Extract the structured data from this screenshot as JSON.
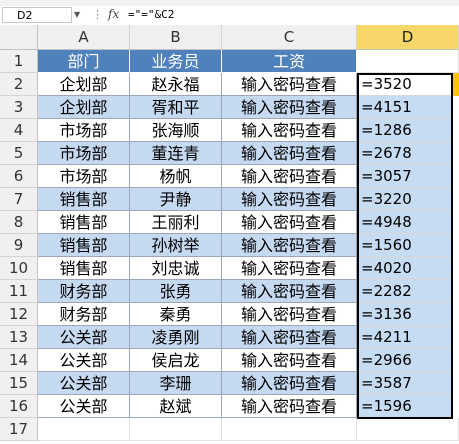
{
  "formula_bar": {
    "name_box": "D2",
    "fx_symbol": "fx",
    "formula": "=\"=\"&C2"
  },
  "columns": [
    "A",
    "B",
    "C",
    "D"
  ],
  "row_numbers": [
    "1",
    "2",
    "3",
    "4",
    "5",
    "6",
    "7",
    "8",
    "9",
    "10",
    "11",
    "12",
    "13",
    "14",
    "15",
    "16",
    "17"
  ],
  "table": {
    "headers": [
      "部门",
      "业务员",
      "工资"
    ],
    "rows": [
      {
        "dept": "企划部",
        "name": "赵永福",
        "salary": "输入密码查看",
        "d": "=3520"
      },
      {
        "dept": "企划部",
        "name": "胥和平",
        "salary": "输入密码查看",
        "d": "=4151"
      },
      {
        "dept": "市场部",
        "name": "张海顺",
        "salary": "输入密码查看",
        "d": "=1286"
      },
      {
        "dept": "市场部",
        "name": "董连青",
        "salary": "输入密码查看",
        "d": "=2678"
      },
      {
        "dept": "市场部",
        "name": "杨帆",
        "salary": "输入密码查看",
        "d": "=3057"
      },
      {
        "dept": "销售部",
        "name": "尹静",
        "salary": "输入密码查看",
        "d": "=3220"
      },
      {
        "dept": "销售部",
        "name": "王丽利",
        "salary": "输入密码查看",
        "d": "=4948"
      },
      {
        "dept": "销售部",
        "name": "孙树举",
        "salary": "输入密码查看",
        "d": "=1560"
      },
      {
        "dept": "销售部",
        "name": "刘忠诚",
        "salary": "输入密码查看",
        "d": "=4020"
      },
      {
        "dept": "财务部",
        "name": "张勇",
        "salary": "输入密码查看",
        "d": "=2282"
      },
      {
        "dept": "财务部",
        "name": "秦勇",
        "salary": "输入密码查看",
        "d": "=3136"
      },
      {
        "dept": "公关部",
        "name": "凌勇刚",
        "salary": "输入密码查看",
        "d": "=4211"
      },
      {
        "dept": "公关部",
        "name": "侯启龙",
        "salary": "输入密码查看",
        "d": "=2966"
      },
      {
        "dept": "公关部",
        "name": "李珊",
        "salary": "输入密码查看",
        "d": "=3587"
      },
      {
        "dept": "公关部",
        "name": "赵斌",
        "salary": "输入密码查看",
        "d": "=1596"
      }
    ]
  },
  "colors": {
    "header_fill": "#4f81bd",
    "band_fill": "#c5d9f1",
    "selected_col_header": "#f7d76a",
    "selection_fill": "#c5dcf3"
  }
}
